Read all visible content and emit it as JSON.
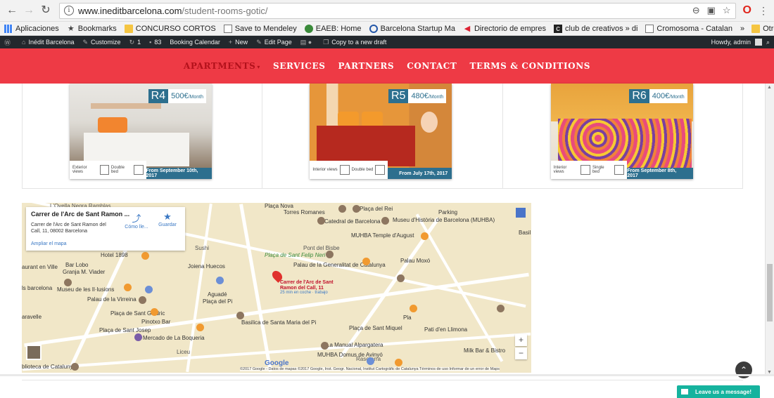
{
  "browser": {
    "url_host": "www.ineditbarcelona.com",
    "url_path": "/student-rooms-gotic/",
    "bookmarks": [
      {
        "label": "Aplicaciones",
        "icon": "apps-grid-icon"
      },
      {
        "label": "Bookmarks",
        "icon": "star-icon"
      },
      {
        "label": "CONCURSO CORTOS",
        "icon": "folder-icon"
      },
      {
        "label": "Save to Mendeley",
        "icon": "page-icon"
      },
      {
        "label": "EAEB: Home",
        "icon": "site-icon"
      },
      {
        "label": "Barcelona Startup Ma",
        "icon": "site-icon"
      },
      {
        "label": "Directorio de empres",
        "icon": "site-icon"
      },
      {
        "label": "club de creativos » di",
        "icon": "site-icon"
      },
      {
        "label": "Cromosoma - Catalan",
        "icon": "page-icon"
      }
    ],
    "more": "»",
    "other_bookmarks": "Otros marcadores"
  },
  "wpbar": {
    "site": "Inédit Barcelona",
    "customize": "Customize",
    "updates": "1",
    "comments": "83",
    "booking": "Booking Calendar",
    "new": "New",
    "edit": "Edit Page",
    "copy": "Copy to a new draft",
    "howdy": "Howdy, admin"
  },
  "nav": {
    "items": [
      "APARTMENTS",
      "SERVICES",
      "PARTNERS",
      "CONTACT",
      "TERMS & CONDITIONS"
    ]
  },
  "rooms": [
    {
      "code": "R4",
      "price": "500€",
      "per": "/Month",
      "view": "Exterior views",
      "bed": "Double bed",
      "date": "From September 10th, 2017"
    },
    {
      "code": "R5",
      "price": "480€",
      "per": "/Month",
      "view": "Interior views",
      "bed": "Double bed",
      "date": "From July 17th, 2017"
    },
    {
      "code": "R6",
      "price": "400€",
      "per": "/Month",
      "view": "Interior views",
      "bed": "Single bed",
      "date": "From September 8th, 2017"
    }
  ],
  "map": {
    "place_title": "Carrer de l'Arc de Sant Ramon ...",
    "place_address": "Carrer de l'Arc de Sant Ramon del Call, 11, 08002 Barcelona",
    "directions": "Cómo lle...",
    "save": "Guardar",
    "enlarge": "Ampliar el mapa",
    "pin_label": "Carrer de l'Arc de Sant Ramon del Call, 11",
    "pin_sub": "25 min en coche · trabajo",
    "labels": [
      "L'Ovella Negra Ramblas",
      "Plaça Nova",
      "Torres Romanes",
      "Plaça del Rei",
      "Parking",
      "Catedral de Barcelona",
      "Museu d'Història de Barcelona (MUHBA)",
      "MUHBA Temple d'August",
      "Pont del Bisbe",
      "Plaça de Sant Felip Neri",
      "Hotel 1898",
      "Bar Lobo",
      "Granja M. Viader",
      "Sushi",
      "Joiena Huecos",
      "Palau de la Generalitat de Catalunya",
      "Palau Moxó",
      "Museu de les Il·lusions",
      "Palau de la Virreina",
      "Aguadé",
      "Plaça del Pi",
      "Basilica de Santa Maria del Pi",
      "Plaça de Sant Galdric",
      "Pinotxo Bar",
      "Plaça de Sant Josep",
      "Mercado de La Boqueria",
      "Plaça de Sant Miquel",
      "La Manual Alpargatera",
      "MUHBA Domus de Avinyó",
      "Rasoterra",
      "Milk Bar & Bistro",
      "Pla",
      "Pati d'en Llimona",
      "Liceu",
      "aurant en Ville",
      "ls barcelona",
      "aravelle",
      "blioteca de Catalunya",
      "Basil"
    ],
    "footer": "©2017 Google - Datos de mapas ©2017 Google, Inst. Geogr. Nacional, Institut Cartogràfic de Catalunya   Términos de uso   Informar de un error de Maps",
    "google": "Google"
  },
  "chat": "Leave us a message!"
}
